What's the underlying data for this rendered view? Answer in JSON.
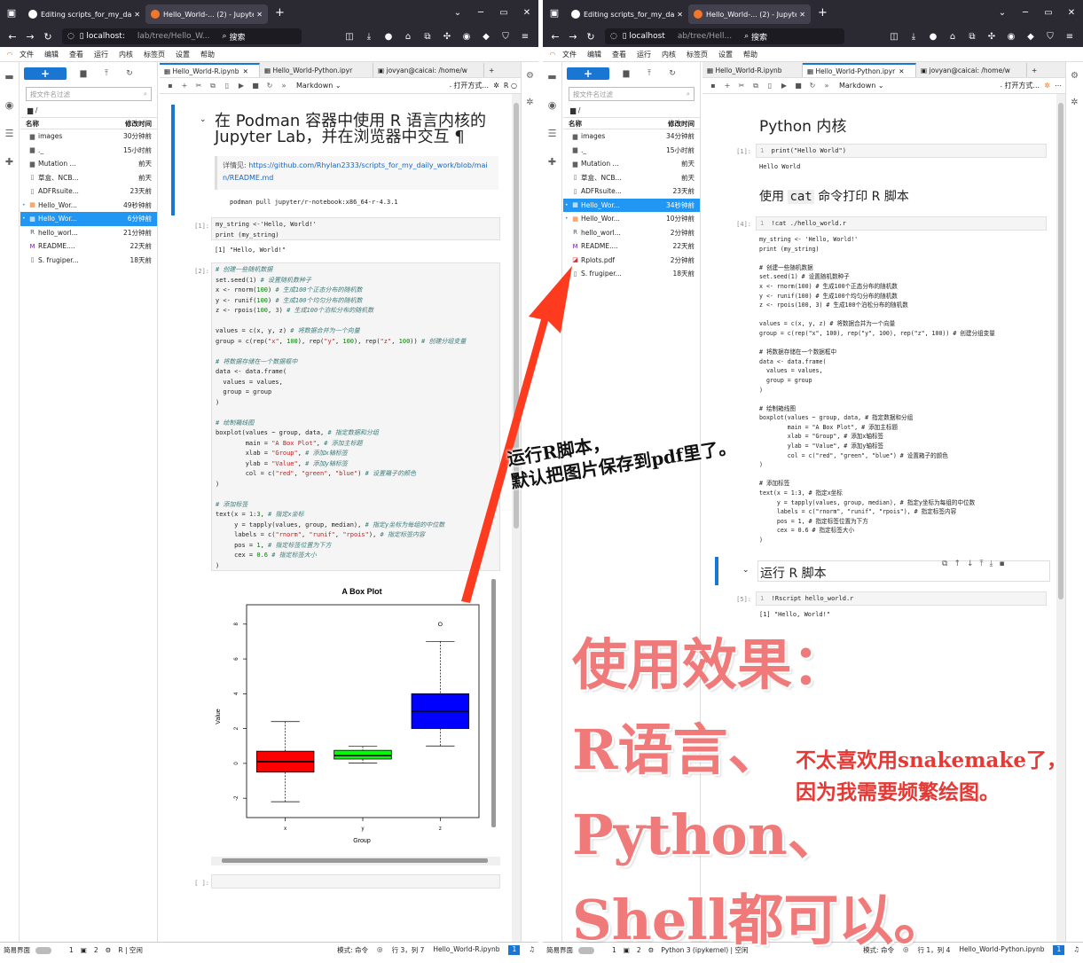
{
  "browser_left": {
    "tabs": [
      {
        "title": "Editing scripts_for_my_daily",
        "active": false
      },
      {
        "title": "Hello_World-... (2) - JupyterL",
        "active": true
      }
    ],
    "url_host": "localhost:",
    "url_path": "lab/tree/Hello_W...",
    "search_label": "搜索"
  },
  "browser_right": {
    "tabs": [
      {
        "title": "Editing scripts_for_my_daily",
        "active": false
      },
      {
        "title": "Hello_World-... (2) - JupyterL",
        "active": true
      }
    ],
    "url_host": "localhost",
    "url_path": "ab/tree/Hell...",
    "search_label": "搜索"
  },
  "menu": [
    "文件",
    "编辑",
    "查看",
    "运行",
    "内核",
    "标签页",
    "设置",
    "帮助"
  ],
  "file_browser": {
    "filter_placeholder": "按文件名过滤",
    "path": "/",
    "col_name": "名称",
    "col_modified": "修改时间"
  },
  "files_left": [
    {
      "name": "images",
      "modified": "30分钟前",
      "icon": "folder"
    },
    {
      "name": "._",
      "modified": "15小时前",
      "icon": "folder"
    },
    {
      "name": "Mutation ...",
      "modified": "前天",
      "icon": "folder"
    },
    {
      "name": "草盒、NCB...",
      "modified": "前天",
      "icon": "file"
    },
    {
      "name": "ADFRsuite...",
      "modified": "23天前",
      "icon": "file"
    },
    {
      "name": "Hello_Wor...",
      "modified": "49秒钟前",
      "icon": "notebook"
    },
    {
      "name": "Hello_Wor...",
      "modified": "6分钟前",
      "icon": "notebook",
      "selected": true
    },
    {
      "name": "hello_worl...",
      "modified": "21分钟前",
      "icon": "r"
    },
    {
      "name": "README....",
      "modified": "22天前",
      "icon": "md"
    },
    {
      "name": "S. frugiper...",
      "modified": "18天前",
      "icon": "file"
    }
  ],
  "files_right": [
    {
      "name": "images",
      "modified": "34分钟前",
      "icon": "folder"
    },
    {
      "name": "._",
      "modified": "15小时前",
      "icon": "folder"
    },
    {
      "name": "Mutation ...",
      "modified": "前天",
      "icon": "folder"
    },
    {
      "name": "草盒、NCB...",
      "modified": "前天",
      "icon": "file"
    },
    {
      "name": "ADFRsuite...",
      "modified": "23天前",
      "icon": "file"
    },
    {
      "name": "Hello_Wor...",
      "modified": "34秒钟前",
      "icon": "notebook",
      "selected": true
    },
    {
      "name": "Hello_Wor...",
      "modified": "10分钟前",
      "icon": "notebook"
    },
    {
      "name": "hello_worl...",
      "modified": "2分钟前",
      "icon": "r"
    },
    {
      "name": "README....",
      "modified": "22天前",
      "icon": "md"
    },
    {
      "name": "Rplots.pdf",
      "modified": "2分钟前",
      "icon": "pdf",
      "underline": true
    },
    {
      "name": "S. frugiper...",
      "modified": "18天前",
      "icon": "file"
    }
  ],
  "doc_tabs": [
    "Hello_World-R.ipynb",
    "Hello_World-Python.ipyr",
    "jovyan@caicai: /home/w"
  ],
  "toolbar": {
    "cell_type": "Markdown",
    "open_with": "打开方式..."
  },
  "left_nb": {
    "title": "在 Podman 容器中使用 R 语言内核的 Jupyter Lab，并在浏览器中交互 ¶",
    "details_label": "详情见: ",
    "details_link": "https://github.com/Rhylan2333/scripts_for_my_daily_work/blob/main/README.md",
    "pull_cmd": "podman pull jupyter/r-notebook:x86_64-r-4.3.1",
    "cell1_prompt": "[1]:",
    "cell1_code": [
      "my_string <-'Hello, World!'",
      "print (my_string)"
    ],
    "cell1_out": "[1] \"Hello, World!\"",
    "cell2_prompt": "[2]:",
    "empty_prompt": "[ ]:"
  },
  "plot": {
    "title": "A Box Plot",
    "xlabel": "Group",
    "ylabel": "Value"
  },
  "chart_data": {
    "type": "box",
    "title": "A Box Plot",
    "xlabel": "Group",
    "ylabel": "Value",
    "categories": [
      "x",
      "y",
      "z"
    ],
    "colors": [
      "#ff0000",
      "#00ff00",
      "#0000ff"
    ],
    "boxes": [
      {
        "name": "x",
        "whisker_low": -2.2,
        "q1": -0.5,
        "median": 0.1,
        "q3": 0.7,
        "whisker_high": 2.4
      },
      {
        "name": "y",
        "whisker_low": 0.02,
        "q1": 0.25,
        "median": 0.45,
        "q3": 0.75,
        "whisker_high": 0.98
      },
      {
        "name": "z",
        "whisker_low": 1.0,
        "q1": 2.0,
        "median": 3.0,
        "q3": 4.0,
        "whisker_high": 7.0,
        "outliers": [
          8.0
        ]
      }
    ],
    "yticks": [
      -2,
      0,
      2,
      4,
      6,
      8
    ],
    "ylim": [
      -2.5,
      8.5
    ]
  },
  "right_nb": {
    "title": "Python 内核",
    "c1_prompt": "[1]:",
    "c1_code": "print(\"Hello World\")",
    "c1_out": "Hello World",
    "h2_pre": "使用 ",
    "h2_code": "cat",
    "h2_post": " 命令打印 R 脚本",
    "c4_prompt": "[4]:",
    "c4_code": "!cat ./hello_world.r",
    "h3": "运行 R 脚本",
    "c5_prompt": "[5]:",
    "c5_code": "!Rscript hello_world.r",
    "c5_out": "[1] \"Hello, World!\""
  },
  "status_left": {
    "mode_label": "简易界面",
    "n1": "1",
    "n2": "2",
    "kernel": "R | 空闲",
    "mode": "模式: 命令",
    "pos": "行 3，列 7",
    "file": "Hello_World-R.ipynb",
    "badge": "1"
  },
  "status_right": {
    "mode_label": "简易界面",
    "n1": "1",
    "n2": "2",
    "kernel": "Python 3 (ipykernel) | 空闲",
    "mode": "模式: 命令",
    "pos": "行 1，列 4",
    "file": "Hello_World-Python.ipynb",
    "badge": "1"
  },
  "annotations": {
    "arrow_text_1": "运行R脚本，",
    "arrow_text_2": "默认把图片保存到pdf里了。",
    "big_1": "使用效果：",
    "big_2": "R语言、",
    "big_3": "Python、",
    "big_4": "Shell都可以。",
    "side_1": "不太喜欢用snakemake了，",
    "side_2": "因为我需要频繁绘图。"
  }
}
